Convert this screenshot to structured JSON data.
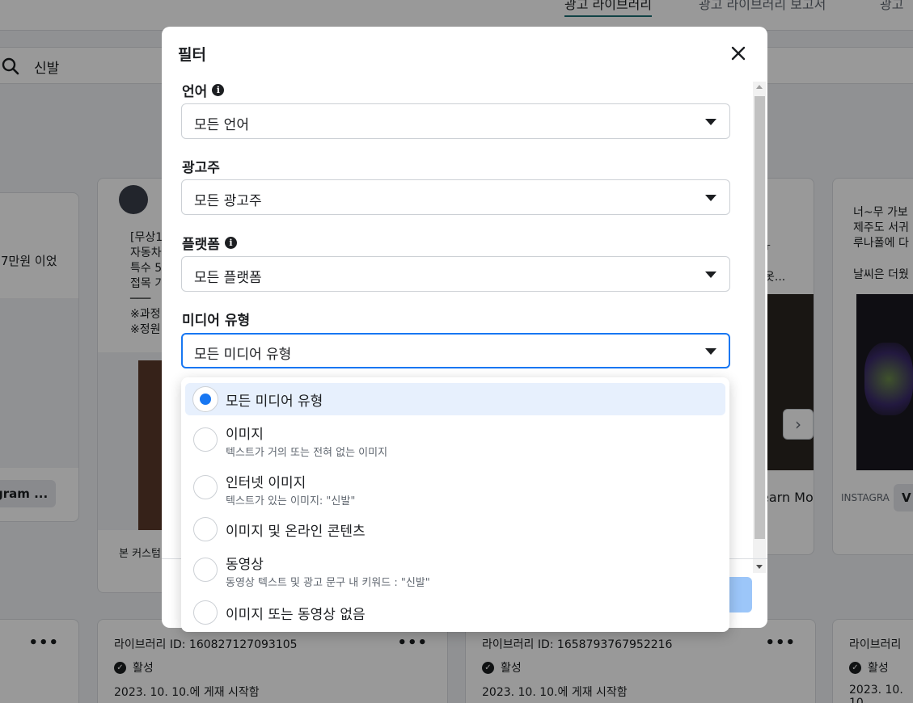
{
  "topnav": {
    "tabs": [
      "광고 라이브러리",
      "광고 라이브러리 보고서",
      "광고"
    ]
  },
  "search": {
    "query": "신발"
  },
  "background": {
    "card_left_text": "7만원 이었",
    "card_left_button": "gram ...",
    "card2_lines": [
      "[무상1",
      "자동차",
      "특수 5",
      "접목 기",
      "───",
      "※과정",
      "※정원"
    ],
    "card2_footer": "본 커스텀",
    "card3_lines": [
      "ㅠ",
      "옷..."
    ],
    "card3_button": "earn Mo",
    "card4_lines": [
      "너~무 가보",
      "제주도 서귀",
      "루나폴에 다",
      "",
      "날씨은 더웠"
    ],
    "card4_platform": "INSTAGRA",
    "card4_button": "V",
    "bottom_cards": [
      {
        "library_id": "",
        "status": "",
        "date": "",
        "more": "•••"
      },
      {
        "library_id": "라이브러리 ID: 160827127093105",
        "status": "활성",
        "date": "2023. 10. 10.에 게재 시작함",
        "more": "•••"
      },
      {
        "library_id": "라이브러리 ID: 1658793767952216",
        "status": "활성",
        "date": "2023. 10. 10.에 게재 시작함",
        "more": "•••"
      },
      {
        "library_id": "라이브러리",
        "status": "활성",
        "date": "2023. 10. 10",
        "more": ""
      }
    ]
  },
  "modal": {
    "title": "필터",
    "fields": [
      {
        "label": "언어",
        "value": "모든 언어",
        "info": true
      },
      {
        "label": "광고주",
        "value": "모든 광고주",
        "info": false
      },
      {
        "label": "플랫폼",
        "value": "모든 플랫폼",
        "info": true
      },
      {
        "label": "미디어 유형",
        "value": "모든 미디어 유형",
        "info": false
      }
    ],
    "info_glyph": "i"
  },
  "dropdown": {
    "options": [
      {
        "label": "모든 미디어 유형",
        "desc": "",
        "selected": true
      },
      {
        "label": "이미지",
        "desc": "텍스트가 거의 또는 전혀 없는 이미지",
        "selected": false
      },
      {
        "label": "인터넷 이미지",
        "desc": "텍스트가 있는 이미지: \"신발\"",
        "selected": false
      },
      {
        "label": "이미지 및 온라인 콘텐츠",
        "desc": "",
        "selected": false
      },
      {
        "label": "동영상",
        "desc": "동영상 텍스트 및 광고 문구 내 키워드 : \"신발\"",
        "selected": false
      },
      {
        "label": "이미지 또는 동영상 없음",
        "desc": "",
        "selected": false
      }
    ]
  },
  "colors": {
    "accent": "#1877f2",
    "selected_bg": "#e7f0fd",
    "overlay": "rgba(0,0,0,0.4)"
  },
  "icons": {
    "search": "search-icon",
    "close": "close-icon",
    "next": "›"
  }
}
